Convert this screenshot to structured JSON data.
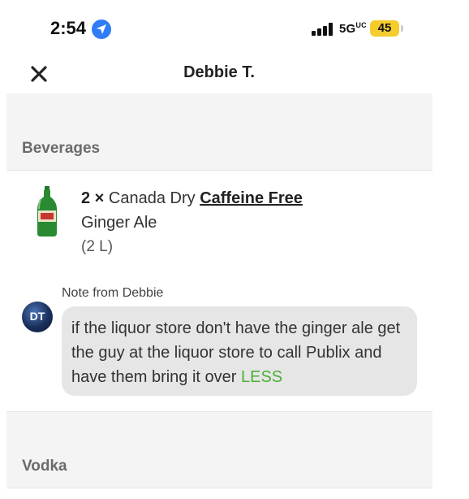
{
  "status_bar": {
    "time": "2:54",
    "network": "5G",
    "network_sup": "UC",
    "battery": "45",
    "battery_color": "#f5cc2c"
  },
  "header": {
    "title": "Debbie T.",
    "close_icon": "close-icon"
  },
  "sections": {
    "beverages": "Beverages",
    "vodka": "Vodka"
  },
  "item": {
    "quantity": "2 ×",
    "name_prefix": "Canada Dry",
    "name_highlight": "Caffeine Free",
    "name_line2": "Ginger Ale",
    "size": "(2 L)",
    "image_icon": "ginger-ale-bottle"
  },
  "note": {
    "label": "Note from Debbie",
    "avatar_initials": "DT",
    "text": "if the liquor store don't have the ginger ale get the guy at the liquor store to call Publix and have them bring it over",
    "toggle": "LESS",
    "toggle_color": "#4caf35"
  }
}
